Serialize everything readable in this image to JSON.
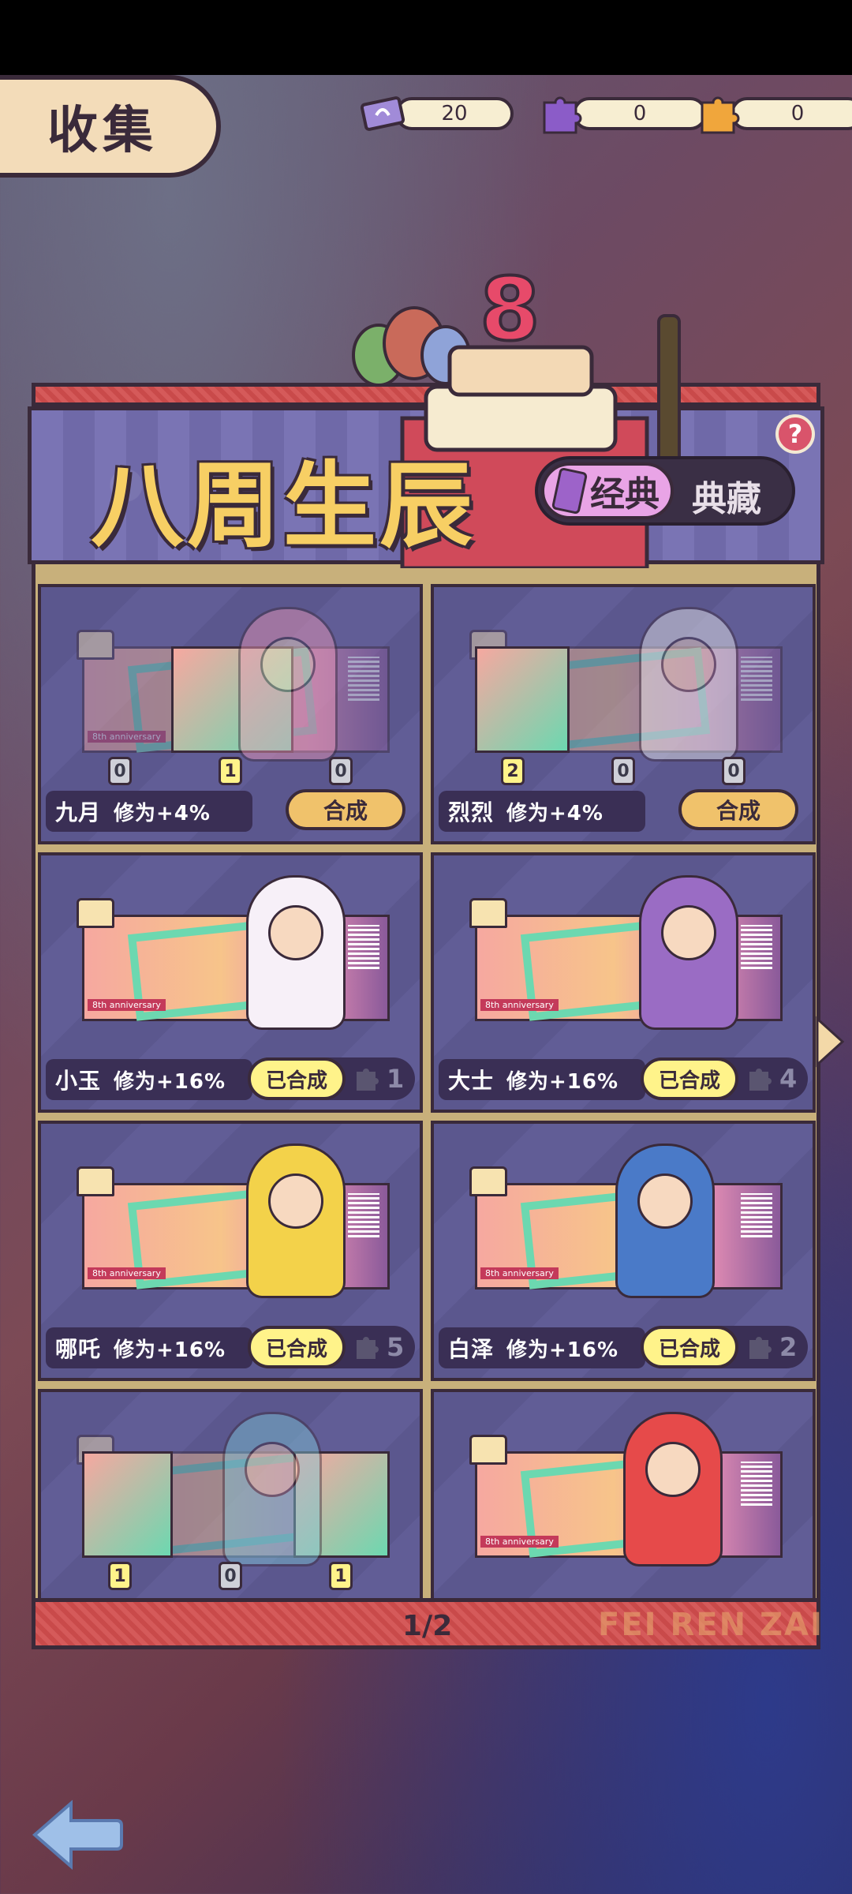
{
  "header": {
    "title": "收集",
    "currencies": [
      {
        "icon": "ticket-icon",
        "value": "20"
      },
      {
        "icon": "purple-puzzle-icon",
        "value": "0"
      },
      {
        "icon": "orange-puzzle-icon",
        "value": "0"
      }
    ]
  },
  "banner": {
    "title": "八周生辰",
    "toggle_on": "经典",
    "toggle_off": "典藏",
    "help": "?"
  },
  "cards": [
    {
      "name": "九月",
      "bonus": "修为+4%",
      "state": "make",
      "button": "合成",
      "slots": [
        "0",
        "1",
        "0"
      ]
    },
    {
      "name": "烈烈",
      "bonus": "修为+4%",
      "state": "make",
      "button": "合成",
      "slots": [
        "2",
        "0",
        "0"
      ]
    },
    {
      "name": "小玉",
      "bonus": "修为+16%",
      "state": "done",
      "button": "已合成",
      "count": "1"
    },
    {
      "name": "大士",
      "bonus": "修为+16%",
      "state": "done",
      "button": "已合成",
      "count": "4"
    },
    {
      "name": "哪吒",
      "bonus": "修为+16%",
      "state": "done",
      "button": "已合成",
      "count": "5"
    },
    {
      "name": "白泽",
      "bonus": "修为+16%",
      "state": "done",
      "button": "已合成",
      "count": "2"
    },
    {
      "name": "",
      "bonus": "",
      "state": "partial",
      "slots": [
        "1",
        "0",
        "1"
      ]
    },
    {
      "name": "",
      "bonus": "",
      "state": "full"
    }
  ],
  "pager": {
    "page": "1/2",
    "brand": "FEI REN ZAI"
  },
  "colors": {
    "accent": "#f0c26b",
    "done": "#fff38a",
    "frame": "#3a2a3a"
  }
}
